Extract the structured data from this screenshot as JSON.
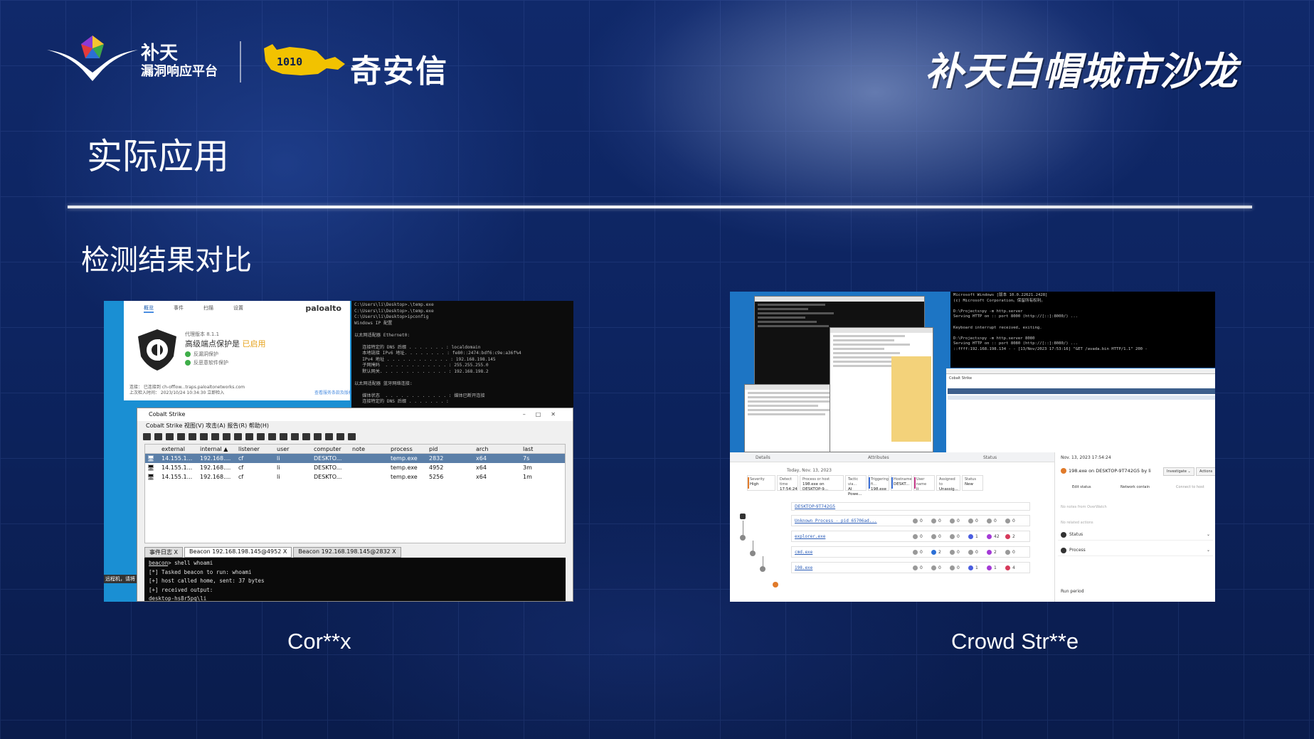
{
  "header": {
    "brand_line1": "补天",
    "brand_line2": "漏洞响应平台",
    "partner": "奇安信",
    "partner_digits": "1010",
    "event": "补天白帽城市沙龙"
  },
  "slide": {
    "title": "实际应用",
    "subtitle": "检测结果对比"
  },
  "left_panel": {
    "caption": "Cor**x",
    "paloalto": {
      "tabs": [
        "概览",
        "事件",
        "扫描",
        "设置"
      ],
      "logo": "paloalto",
      "version": "代理版本 8.1.1",
      "status_prefix": "高级端点保护是",
      "status_value": "已启用",
      "checks": [
        "反漏洞保护",
        "反恶意软件保护"
      ],
      "footer": [
        "连接：    已连接到 ch-offlow...traps.paloaltonetworks.com",
        "上次检入时间：  2023/10/24 10:34:30    立即检入"
      ],
      "footer_link": "查看服务条款及版权"
    },
    "cmd_lines": "C:\\Users\\li\\Desktop>.\\temp.exe\nC:\\Users\\li\\Desktop>.\\temp.exe\nC:\\Users\\li\\Desktop>ipconfig\nWindows IP 配置\n\n以太网适配器 Ethernet0:\n\n   连接特定的 DNS 后缀 . . . . . . . : localdomain\n   本地链接 IPv6 地址. . . . . . . . : fe80::2474:bdf6:c9e:a36f%4\n   IPv4 地址 . . . . . . . . . . . . : 192.168.198.145\n   子网掩码  . . . . . . . . . . . . : 255.255.255.0\n   默认网关. . . . . . . . . . . . . : 192.168.198.2\n\n以太网适配器 蓝牙网络连接:\n\n   媒体状态  . . . . . . . . . . . . : 媒体已断开连接\n   连接特定的 DNS 后缀 . . . . . . . :\n\nC:\\Users\\li\\Desktop>.\\temp.exe\nC:\\Users\\li\\Desktop>",
    "cs": {
      "title": "Cobalt Strike",
      "menu": "Cobalt Strike  视图(V)  攻击(A)  报告(R)  帮助(H)",
      "columns": [
        "",
        "external",
        "internal ▲",
        "listener",
        "user",
        "computer",
        "note",
        "process",
        "pid",
        "arch",
        "last"
      ],
      "rows": [
        [
          "",
          "14.155.1...",
          "192.168....",
          "cf",
          "li",
          "DESKTO...",
          "",
          "temp.exe",
          "2832",
          "x64",
          "7s"
        ],
        [
          "",
          "14.155.1...",
          "192.168....",
          "cf",
          "li",
          "DESKTO...",
          "",
          "temp.exe",
          "4952",
          "x64",
          "3m"
        ],
        [
          "",
          "14.155.1...",
          "192.168....",
          "cf",
          "li",
          "DESKTO...",
          "",
          "temp.exe",
          "5256",
          "x64",
          "1m"
        ]
      ],
      "tabs": [
        "事件日志 X",
        "Beacon 192.168.198.145@4952 X",
        "Beacon 192.168.198.145@2832 X"
      ],
      "prompt": "beacon",
      "console": "> shell whoami\n[*] Tasked beacon to run: whoami\n[+] host called home, sent: 37 bytes\n[+] received output:\ndesktop-hs8r5pq\\li"
    },
    "stray": "远程机，请将"
  },
  "right_panel": {
    "caption": "Crowd Str**e",
    "cmd_lines": "Microsoft Windows [版本 10.0.22621.2428]\n(c) Microsoft Corporation。保留所有权利。\n\nD:\\Projects>py -m http.server\nServing HTTP on :: port 8000 (http://[::]:8000/) ...\n\nKeyboard interrupt received, exiting.\n\nD:\\Projects>py -m http.server 8080\nServing HTTP on :: port 8080 (http://[::]:8080/) ...\n::ffff:192.168.198.134 - - [13/Nov/2023 17:53:16] \"GET /avada.bin HTTP/1.1\" 200 -",
    "cs_title": "Cobalt Strike",
    "cols": [
      "Details",
      "Attributes",
      "Status"
    ],
    "today": "Today, Nov. 13, 2023",
    "cards": [
      {
        "k": "Severity",
        "v": "High"
      },
      {
        "k": "Detect time",
        "v": "17:54:24"
      },
      {
        "k": "Process or host",
        "v": "198.exe on DESKTOP-9..."
      },
      {
        "k": "Tactic via...",
        "v": "AI Powe..."
      },
      {
        "k": "Triggering fi...",
        "v": "198.exe"
      },
      {
        "k": "Hostname",
        "v": "DESKT..."
      },
      {
        "k": "User name",
        "v": "li"
      },
      {
        "k": "Assigned to",
        "v": "Unassig..."
      },
      {
        "k": "Status",
        "v": "New"
      }
    ],
    "host": "DESKTOP-9T742G5",
    "procs": [
      {
        "name": "Unknown Process - pid 65706ad...",
        "v": [
          "0",
          "0",
          "0",
          "0",
          "0",
          "0"
        ]
      },
      {
        "name": "explorer.exe",
        "v": [
          "0",
          "0",
          "0",
          "1",
          "42",
          "2"
        ]
      },
      {
        "name": "cmd.exe",
        "v": [
          "0",
          "2",
          "0",
          "0",
          "2",
          "0"
        ]
      },
      {
        "name": "198.exe",
        "v": [
          "0",
          "0",
          "0",
          "1",
          "1",
          "4"
        ]
      }
    ],
    "side": {
      "date": "Nov. 13, 2023 17:54:24",
      "title": "198.exe on DESKTOP-9T742G5 by li",
      "investigate": "Investigate ⌄",
      "actions": "Actions",
      "tabs": [
        "Edit status",
        "Network contain",
        "Connect to host"
      ],
      "no_notes": "No notes from OverWatch",
      "no_actions": "No related actions",
      "status": "Status",
      "process": "Process",
      "run_period": "Run period"
    }
  }
}
